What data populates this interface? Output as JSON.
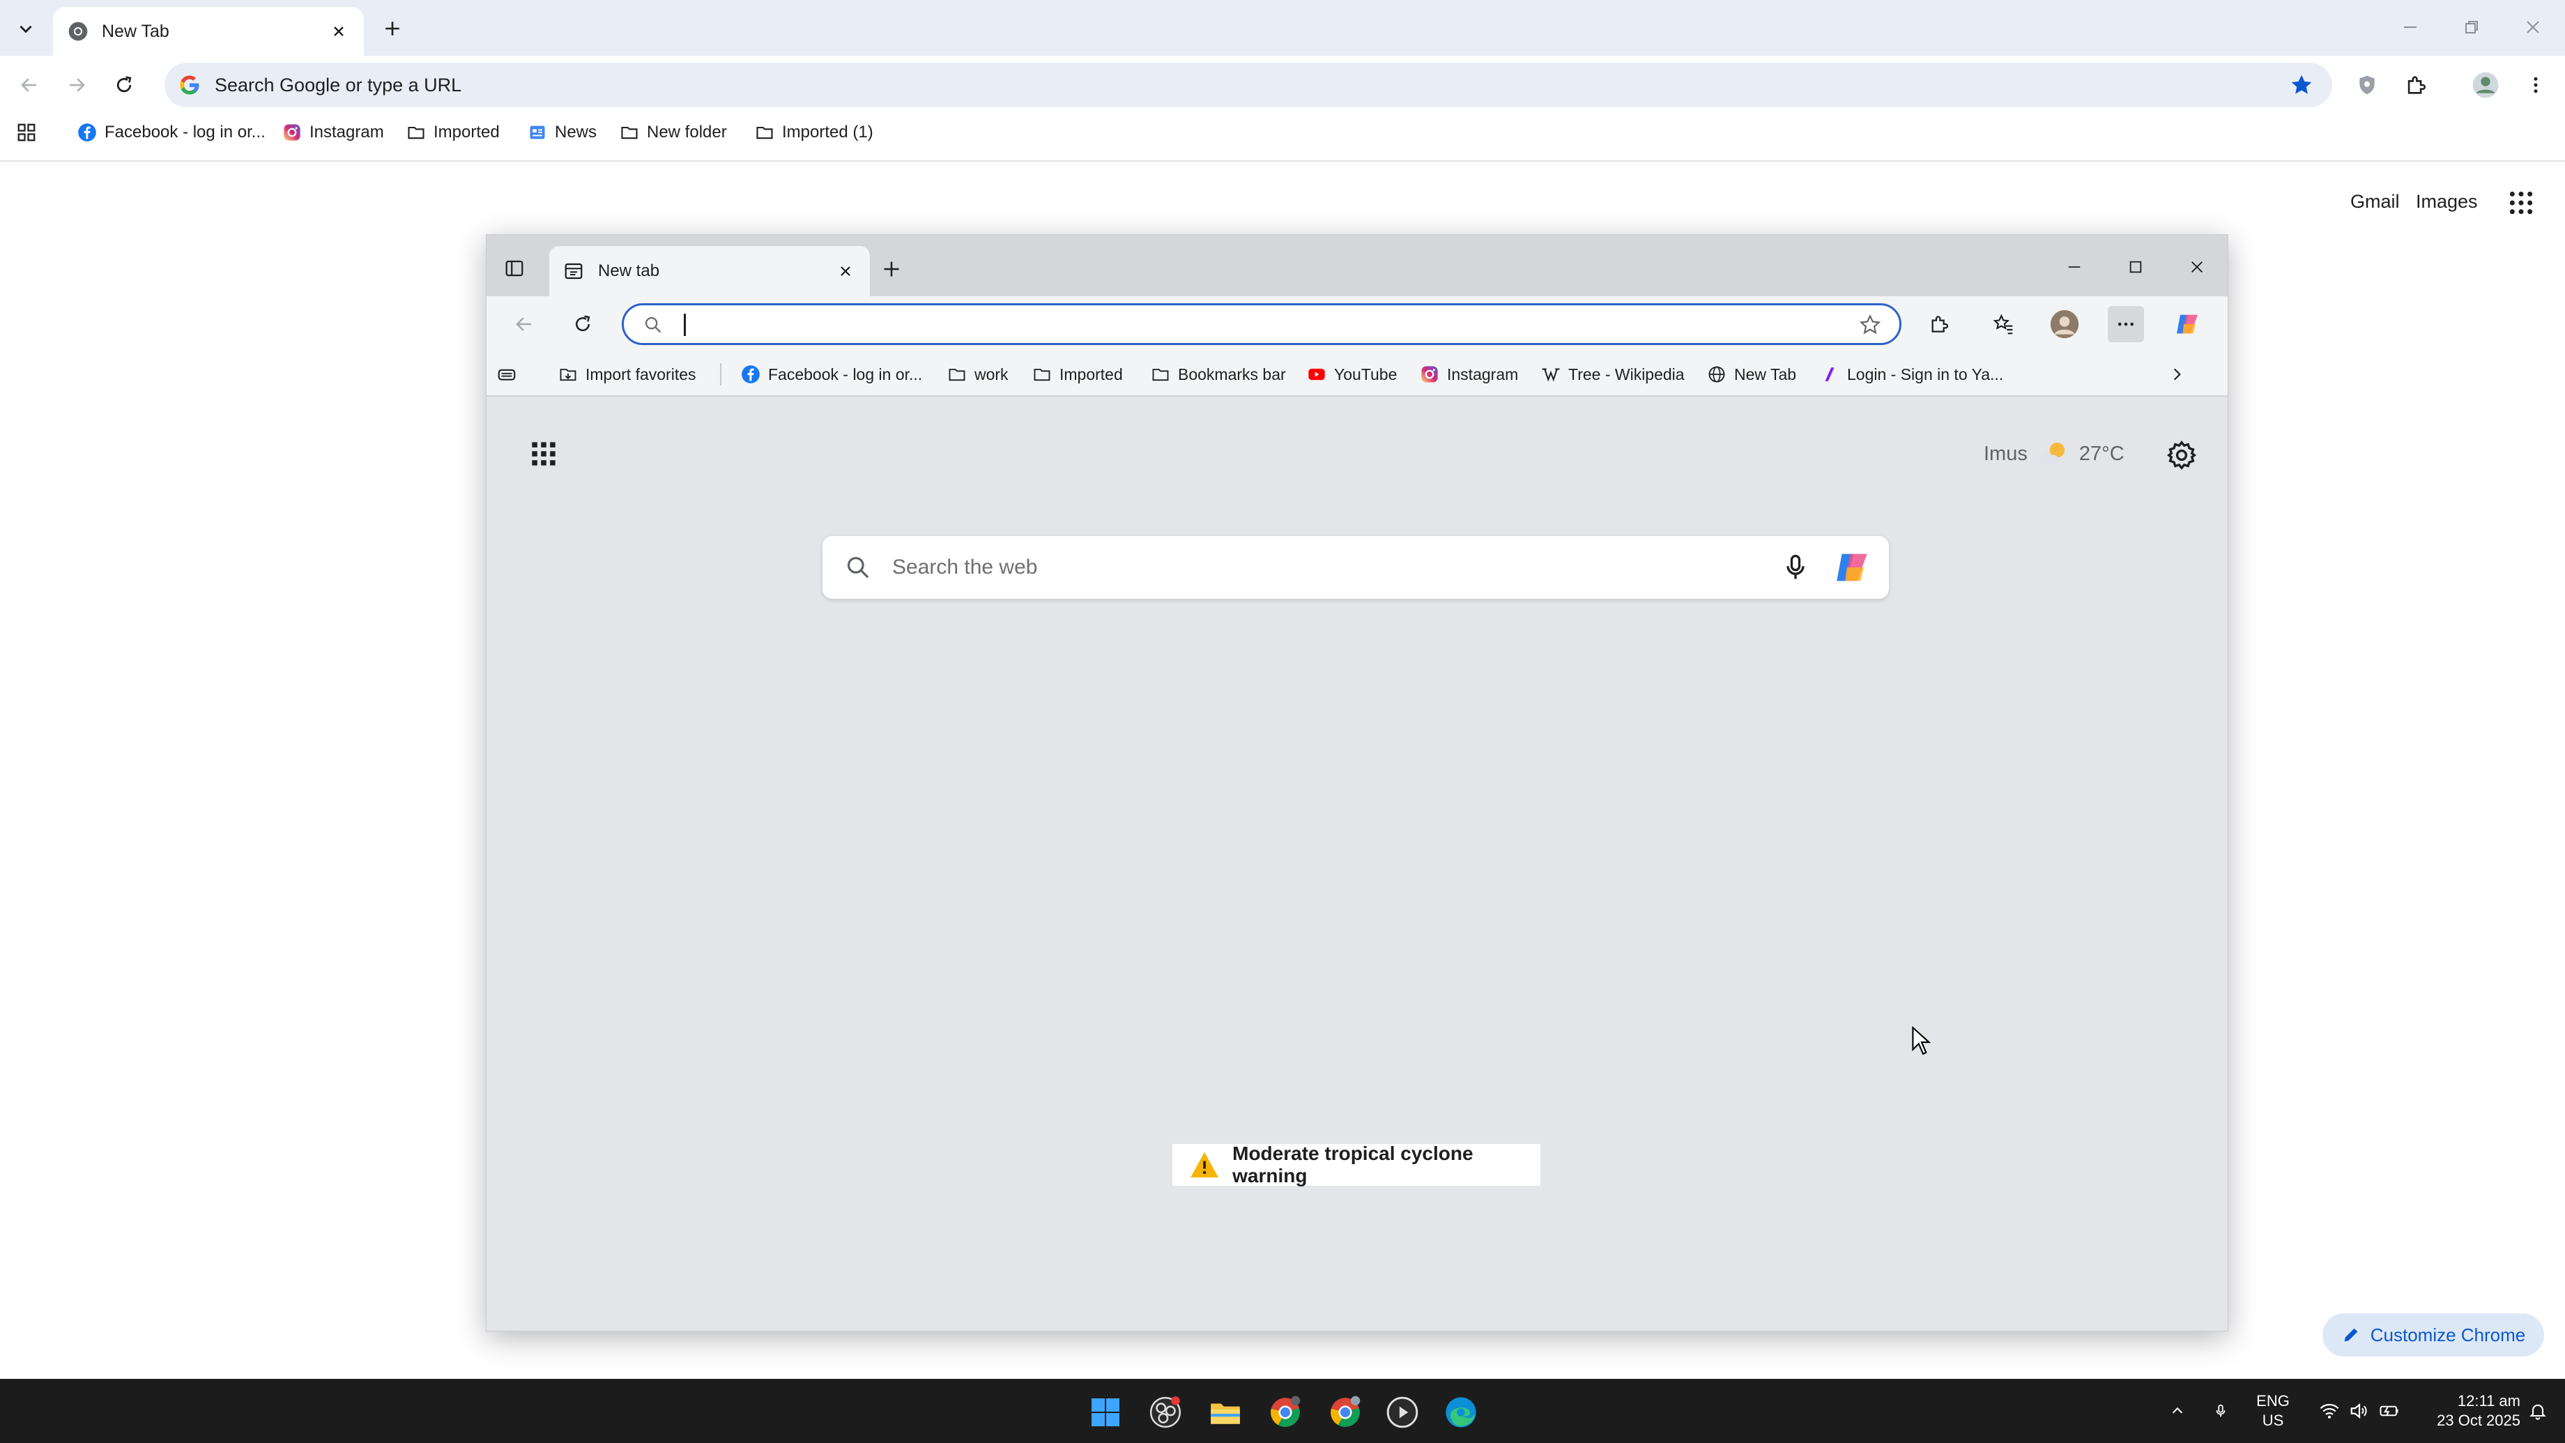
{
  "chrome": {
    "tab_title": "New Tab",
    "omnibox_placeholder": "Search Google or type a URL",
    "bookmarks": [
      {
        "label": "Facebook - log in or...",
        "icon": "facebook-icon"
      },
      {
        "label": "Instagram",
        "icon": "instagram-icon"
      },
      {
        "label": "Imported",
        "icon": "folder-icon"
      },
      {
        "label": "News",
        "icon": "news-icon"
      },
      {
        "label": "New folder",
        "icon": "folder-icon"
      },
      {
        "label": "Imported (1)",
        "icon": "folder-icon"
      }
    ],
    "ntp_links": {
      "gmail": "Gmail",
      "images": "Images"
    },
    "customize_label": "Customize Chrome",
    "colors": {
      "accent": "#0b57d0",
      "tabstrip": "#e9eef6"
    }
  },
  "edge": {
    "tab_title": "New tab",
    "bookmarks": [
      {
        "label": "Import favorites",
        "icon": "import-icon"
      },
      {
        "label": "Facebook - log in or...",
        "icon": "facebook-icon"
      },
      {
        "label": "work",
        "icon": "folder-icon"
      },
      {
        "label": "Imported",
        "icon": "folder-icon"
      },
      {
        "label": "Bookmarks bar",
        "icon": "folder-icon"
      },
      {
        "label": "YouTube",
        "icon": "youtube-icon"
      },
      {
        "label": "Instagram",
        "icon": "instagram-icon"
      },
      {
        "label": "Tree - Wikipedia",
        "icon": "wikipedia-icon"
      },
      {
        "label": "New Tab",
        "icon": "globe-icon"
      },
      {
        "label": "Login - Sign in to Ya...",
        "icon": "yahoo-icon"
      }
    ],
    "weather": {
      "location": "Imus",
      "temperature": "27°C"
    },
    "search_placeholder": "Search the web",
    "alert_text": "Moderate tropical cyclone warning",
    "colors": {
      "address_border": "#2c62c9"
    }
  },
  "taskbar": {
    "language": "ENG",
    "region": "US",
    "time": "12:11 am",
    "date": "23 Oct 2025"
  }
}
